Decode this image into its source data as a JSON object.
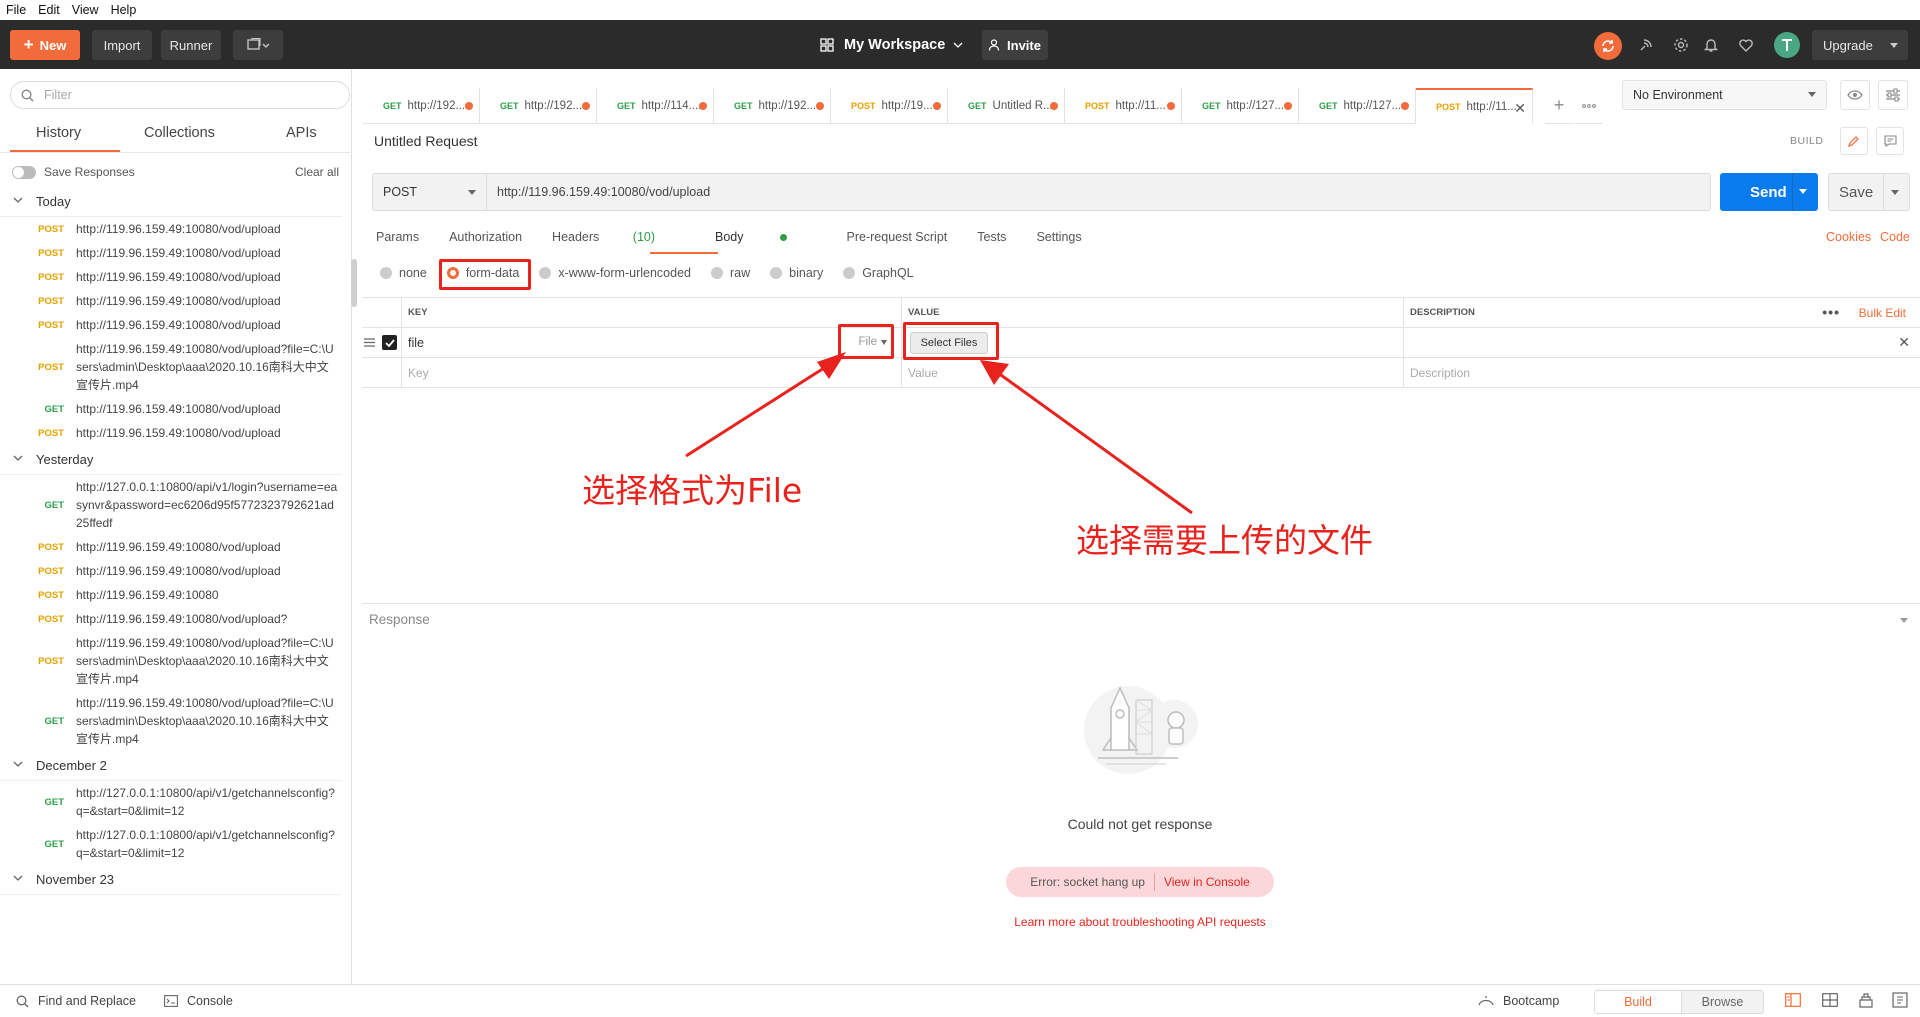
{
  "menu": [
    "File",
    "Edit",
    "View",
    "Help"
  ],
  "header": {
    "new_label": "New",
    "import_label": "Import",
    "runner_label": "Runner",
    "workspace_label": "My Workspace",
    "invite_label": "Invite",
    "upgrade_label": "Upgrade"
  },
  "sidebar": {
    "filter_placeholder": "Filter",
    "tabs": [
      "History",
      "Collections",
      "APIs"
    ],
    "save_responses": "Save Responses",
    "clear_all": "Clear all",
    "groups": [
      {
        "label": "Today",
        "items": [
          {
            "method": "POST",
            "url": "http://119.96.159.49:10080/vod/upload"
          },
          {
            "method": "POST",
            "url": "http://119.96.159.49:10080/vod/upload"
          },
          {
            "method": "POST",
            "url": "http://119.96.159.49:10080/vod/upload"
          },
          {
            "method": "POST",
            "url": "http://119.96.159.49:10080/vod/upload"
          },
          {
            "method": "POST",
            "url": "http://119.96.159.49:10080/vod/upload"
          },
          {
            "method": "POST",
            "url": "http://119.96.159.49:10080/vod/upload?file=C:\\Users\\admin\\Desktop\\aaa\\2020.10.16南科大中文宣传片.mp4"
          },
          {
            "method": "GET",
            "url": "http://119.96.159.49:10080/vod/upload"
          },
          {
            "method": "POST",
            "url": "http://119.96.159.49:10080/vod/upload"
          }
        ]
      },
      {
        "label": "Yesterday",
        "items": [
          {
            "method": "GET",
            "url": "http://127.0.0.1:10800/api/v1/login?username=easynvr&password=ec6206d95f5772323792621ad25ffedf"
          },
          {
            "method": "POST",
            "url": "http://119.96.159.49:10080/vod/upload"
          },
          {
            "method": "POST",
            "url": "http://119.96.159.49:10080/vod/upload"
          },
          {
            "method": "POST",
            "url": "http://119.96.159.49:10080"
          },
          {
            "method": "POST",
            "url": "http://119.96.159.49:10080/vod/upload?"
          },
          {
            "method": "POST",
            "url": "http://119.96.159.49:10080/vod/upload?file=C:\\Users\\admin\\Desktop\\aaa\\2020.10.16南科大中文宣传片.mp4"
          },
          {
            "method": "GET",
            "url": "http://119.96.159.49:10080/vod/upload?file=C:\\Users\\admin\\Desktop\\aaa\\2020.10.16南科大中文宣传片.mp4"
          }
        ]
      },
      {
        "label": "December 2",
        "items": [
          {
            "method": "GET",
            "url": "http://127.0.0.1:10800/api/v1/getchannelsconfig?q=&start=0&limit=12"
          },
          {
            "method": "GET",
            "url": "http://127.0.0.1:10800/api/v1/getchannelsconfig?q=&start=0&limit=12"
          }
        ]
      },
      {
        "label": "November 23",
        "items": []
      }
    ]
  },
  "tabs": [
    {
      "method": "GET",
      "label": "http://192...."
    },
    {
      "method": "GET",
      "label": "http://192...."
    },
    {
      "method": "GET",
      "label": "http://114...."
    },
    {
      "method": "GET",
      "label": "http://192...."
    },
    {
      "method": "POST",
      "label": "http://19..."
    },
    {
      "method": "GET",
      "label": "Untitled R..."
    },
    {
      "method": "POST",
      "label": "http://11..."
    },
    {
      "method": "GET",
      "label": "http://127...."
    },
    {
      "method": "GET",
      "label": "http://127...."
    },
    {
      "method": "POST",
      "label": "http://11..."
    }
  ],
  "environment": "No Environment",
  "request": {
    "title": "Untitled Request",
    "build_label": "BUILD",
    "method": "POST",
    "url": "http://119.96.159.49:10080/vod/upload",
    "send_label": "Send",
    "save_label": "Save",
    "tabs": [
      "Params",
      "Authorization",
      "Headers",
      "Body",
      "Pre-request Script",
      "Tests",
      "Settings"
    ],
    "headers_count": "(10)",
    "cookies": "Cookies",
    "code": "Code",
    "body_types": [
      "none",
      "form-data",
      "x-www-form-urlencoded",
      "raw",
      "binary",
      "GraphQL"
    ],
    "selected_body_type": "form-data",
    "table": {
      "headers": [
        "KEY",
        "VALUE",
        "DESCRIPTION"
      ],
      "bulk_edit": "Bulk Edit",
      "row": {
        "key": "file",
        "type": "File",
        "button": "Select Files"
      },
      "placeholders": {
        "key": "Key",
        "value": "Value",
        "description": "Description"
      }
    }
  },
  "annotations": {
    "file_format": "选择格式为File",
    "select_file": "选择需要上传的文件"
  },
  "response": {
    "title": "Response",
    "message": "Could not get response",
    "error": "Error: socket hang up",
    "view_console": "View in Console",
    "learn_more": "Learn more about troubleshooting API requests"
  },
  "footer": {
    "find_replace": "Find and Replace",
    "console": "Console",
    "bootcamp": "Bootcamp",
    "build": "Build",
    "browse": "Browse"
  },
  "colors": {
    "accent": "#f26b3a",
    "send": "#097bed",
    "annotation": "#e8231d"
  }
}
